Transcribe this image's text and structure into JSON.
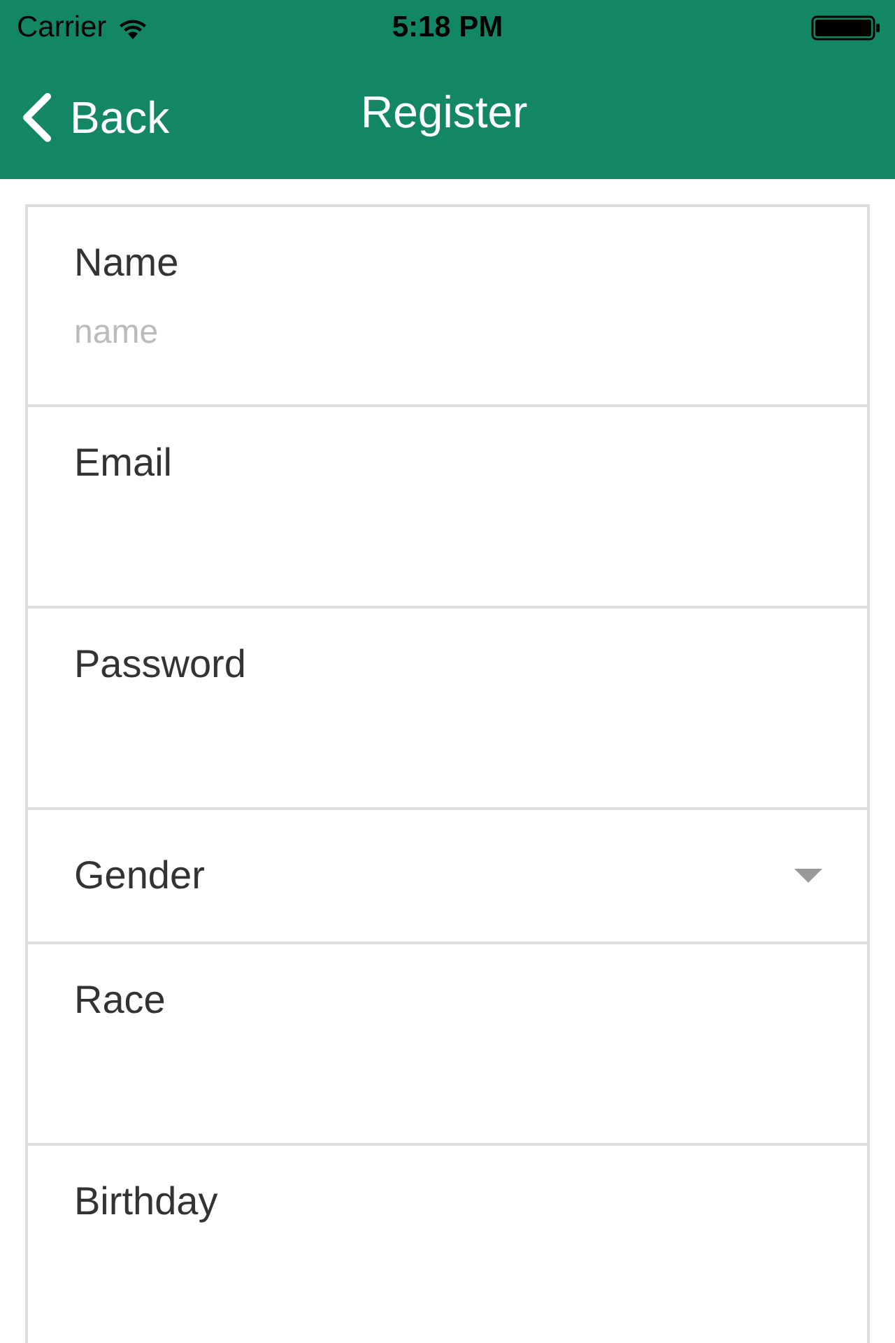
{
  "status_bar": {
    "carrier": "Carrier",
    "time": "5:18 PM"
  },
  "nav": {
    "back": "Back",
    "title": "Register"
  },
  "fields": [
    {
      "kind": "text",
      "label": "Name",
      "placeholder": "name"
    },
    {
      "kind": "text",
      "label": "Email"
    },
    {
      "kind": "text",
      "label": "Password"
    },
    {
      "kind": "select",
      "label": "Gender"
    },
    {
      "kind": "text",
      "label": "Race"
    },
    {
      "kind": "text",
      "label": "Birthday"
    }
  ]
}
